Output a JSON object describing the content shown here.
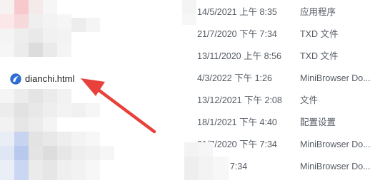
{
  "files": [
    {
      "name": "",
      "date": "14/5/2021 上午 8:35",
      "type": "应用程序"
    },
    {
      "name": "",
      "date": "21/7/2020 下午 7:34",
      "type": "TXD 文件"
    },
    {
      "name": "",
      "date": "13/11/2020 上午 8:56",
      "type": "TXD 文件"
    },
    {
      "name": "dianchi.html",
      "date": "4/3/2022 下午 1:26",
      "type": "MiniBrowser Do...",
      "icon": "browser-icon"
    },
    {
      "name": "",
      "date": "13/12/2021 下午 2:08",
      "type": "文件"
    },
    {
      "name": "",
      "date": "18/1/2021 下午 4:40",
      "type": "配置设置"
    },
    {
      "name": "",
      "date": "21/7/2020 下午 7:34",
      "type": "MiniBrowser Do..."
    },
    {
      "name": "",
      "date": "20 下午 7:34",
      "type": "MiniBrowser Do..."
    }
  ],
  "colors": {
    "annotation_arrow": "#e8403a",
    "browser_icon": "#2f6fd6"
  }
}
